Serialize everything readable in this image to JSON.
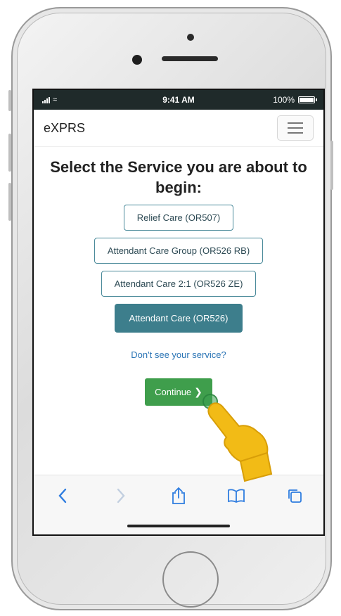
{
  "status_bar": {
    "time": "9:41 AM",
    "battery": "100%"
  },
  "navbar": {
    "brand": "eXPRS"
  },
  "main": {
    "heading": "Select the Service you are about to begin:",
    "services": [
      {
        "label": "Relief Care (OR507)",
        "selected": false
      },
      {
        "label": "Attendant Care Group (OR526 RB)",
        "selected": false
      },
      {
        "label": "Attendant Care 2:1 (OR526 ZE)",
        "selected": false
      },
      {
        "label": "Attendant Care (OR526)",
        "selected": true
      }
    ],
    "dont_see_link": "Don't see your service?",
    "continue_label": "Continue"
  },
  "colors": {
    "accent": "#3d7e8c",
    "continue": "#3f9e4c",
    "link": "#2a74b5"
  },
  "icons": {
    "back": "chevron-left-icon",
    "forward": "chevron-right-icon",
    "share": "share-icon",
    "bookmarks": "book-icon",
    "tabs": "tabs-icon"
  }
}
